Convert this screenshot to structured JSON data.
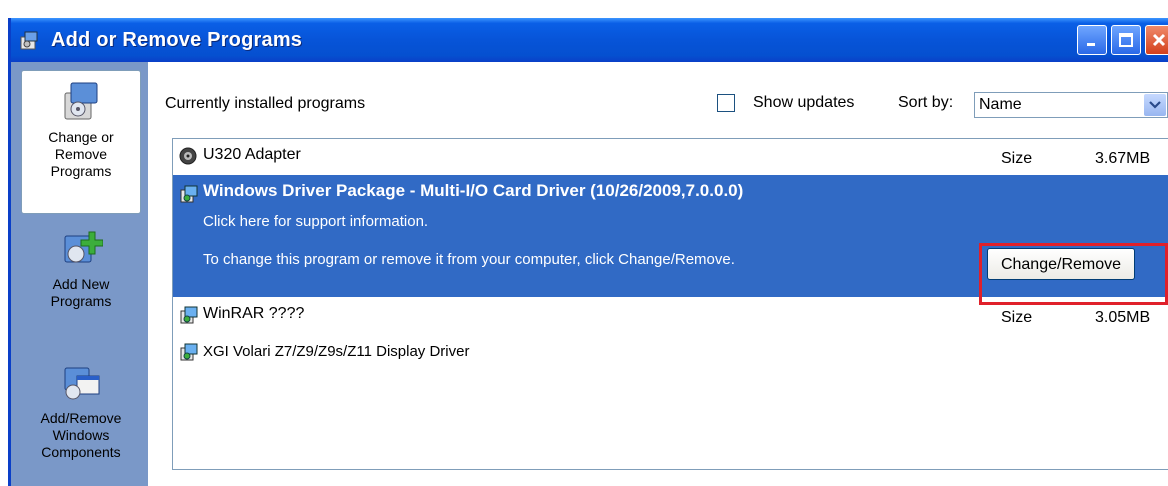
{
  "window": {
    "title": "Add or Remove Programs"
  },
  "sidebar": {
    "items": [
      {
        "label_line1": "Change or",
        "label_line2": "Remove",
        "label_line3": "Programs"
      },
      {
        "label_line1": "Add New",
        "label_line2": "Programs"
      },
      {
        "label_line1": "Add/Remove",
        "label_line2": "Windows",
        "label_line3": "Components"
      }
    ]
  },
  "toolbar": {
    "installed_label": "Currently installed programs",
    "show_updates_label": "Show updates",
    "sort_label": "Sort by:",
    "sort_value": "Name"
  },
  "programs": [
    {
      "name": "U320 Adapter",
      "size_label": "Size",
      "size_value": "3.67MB"
    },
    {
      "name": "Windows Driver Package - Multi-I/O Card Driver (10/26/2009,7.0.0.0)",
      "support_text": "Click here for support information.",
      "change_text": "To change this program or remove it from your computer, click Change/Remove.",
      "button_label": "Change/Remove"
    },
    {
      "name": "WinRAR ????",
      "size_label": "Size",
      "size_value": "3.05MB"
    },
    {
      "name": "XGI Volari Z7/Z9/Z9s/Z11 Display Driver"
    }
  ],
  "colors": {
    "titlebar": "#0754d8",
    "selection": "#316ac5",
    "highlight_box": "#e0202a",
    "sidebar": "#7a98c8"
  }
}
